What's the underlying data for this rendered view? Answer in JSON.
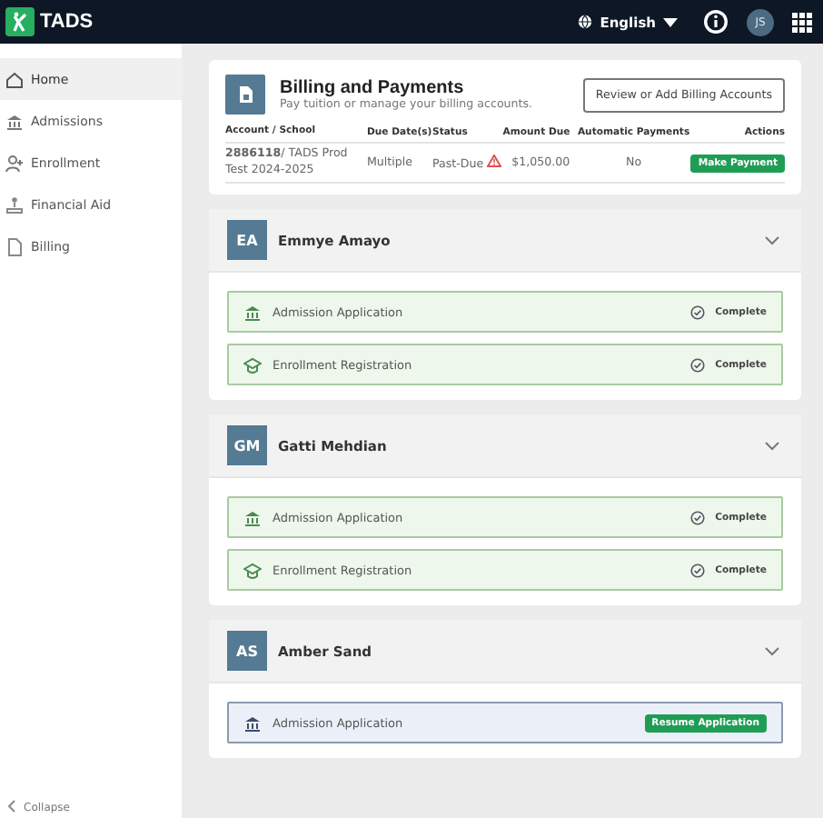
{
  "header": {
    "logo": "TADS",
    "language": "English",
    "user_initials": "JS"
  },
  "sidebar": {
    "items": [
      {
        "label": "Home",
        "selected": true
      },
      {
        "label": "Admissions",
        "selected": false
      },
      {
        "label": "Enrollment",
        "selected": false
      },
      {
        "label": "Financial Aid",
        "selected": false
      },
      {
        "label": "Billing",
        "selected": false
      }
    ],
    "collapse": "Collapse"
  },
  "billing": {
    "title": "Billing and Payments",
    "subtitle": "Pay tuition or manage your billing accounts.",
    "button": "Review or Add Billing Accounts",
    "columns": [
      "Account / School",
      "Due Date(s)",
      "Status",
      "Amount Due",
      "Automatic Payments",
      "Actions"
    ],
    "rows": [
      {
        "account": "**2886118**/ TADS Prod Test 2024-2025",
        "due": "Multiple",
        "status": "Past-Due",
        "warning": true,
        "amount": "$1,050.00",
        "auto": "No",
        "action": "Make Payment"
      }
    ]
  },
  "students": [
    {
      "initials": "EA",
      "name": "Emmye Amayo",
      "expanded": true,
      "items": [
        {
          "kind": "complete",
          "label": "Admission Application",
          "status": "Complete"
        },
        {
          "kind": "complete",
          "label": "Enrollment Registration",
          "status": "Complete"
        }
      ]
    },
    {
      "initials": "GM",
      "name": "Gatti Mehdian",
      "expanded": true,
      "items": [
        {
          "kind": "complete",
          "label": "Admission Application",
          "status": "Complete"
        },
        {
          "kind": "complete",
          "label": "Enrollment Registration",
          "status": "Complete"
        }
      ]
    },
    {
      "initials": "AS",
      "name": "Amber Sand",
      "expanded": true,
      "items": [
        {
          "kind": "resume",
          "label": "Admission Application",
          "action": "Resume Application"
        }
      ]
    }
  ]
}
